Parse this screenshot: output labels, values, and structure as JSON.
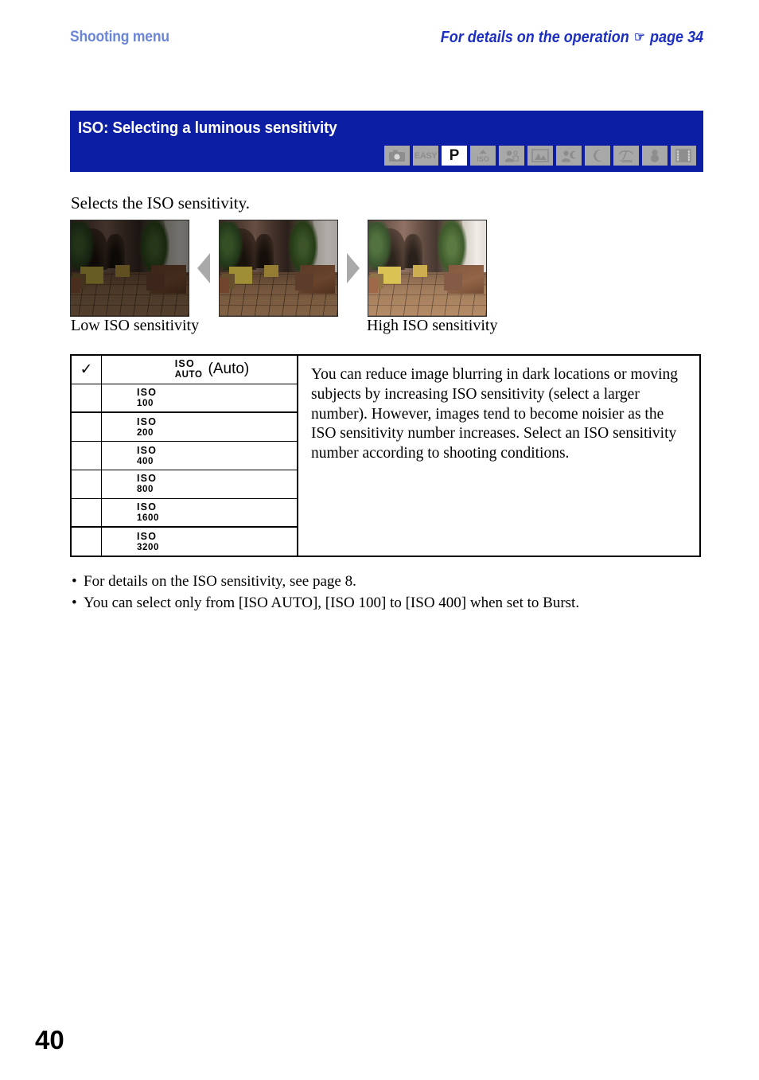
{
  "header": {
    "left_title": "Shooting menu",
    "right_text": "For details on the operation",
    "right_hand_icon": "pointing-hand-icon",
    "right_page_ref": "page 34"
  },
  "banner": {
    "title": "ISO: Selecting a luminous sensitivity",
    "background_color": "#0c1fa4",
    "modes": [
      {
        "name": "still-image-mode",
        "icon": "camera-icon",
        "label": "",
        "active": false
      },
      {
        "name": "easy-shooting-mode",
        "icon": "easy-text-icon",
        "label": "EASY",
        "active": false
      },
      {
        "name": "program-auto-mode",
        "icon": "p-text-icon",
        "label": "P",
        "active": true
      },
      {
        "name": "high-sensitivity-mode",
        "icon": "iso-up-icon",
        "label": "ISO",
        "active": false
      },
      {
        "name": "soft-snap-mode",
        "icon": "soft-snap-icon",
        "label": "",
        "active": false
      },
      {
        "name": "landscape-mode",
        "icon": "landscape-icon",
        "label": "",
        "active": false
      },
      {
        "name": "twilight-portrait-mode",
        "icon": "twilight-portrait-icon",
        "label": "",
        "active": false
      },
      {
        "name": "twilight-mode",
        "icon": "moon-icon",
        "label": "",
        "active": false
      },
      {
        "name": "beach-mode",
        "icon": "palm-tree-icon",
        "label": "",
        "active": false
      },
      {
        "name": "snow-mode",
        "icon": "snowman-icon",
        "label": "",
        "active": false
      },
      {
        "name": "movie-mode",
        "icon": "film-strip-icon",
        "label": "",
        "active": false
      }
    ]
  },
  "intro": "Selects the ISO sensitivity.",
  "photos": {
    "caption_low": "Low ISO sensitivity",
    "caption_high": "High ISO sensitivity",
    "arrow_left_icon": "triangle-left-icon",
    "arrow_right_icon": "triangle-right-icon"
  },
  "table": {
    "options": [
      {
        "checked": true,
        "check_icon": "check-mark-icon",
        "iso_top": "ISO",
        "iso_bottom": "AUTO",
        "suffix": "(Auto)"
      },
      {
        "checked": false,
        "iso_top": "ISO",
        "iso_bottom": "100",
        "suffix": ""
      },
      {
        "checked": false,
        "iso_top": "ISO",
        "iso_bottom": "200",
        "suffix": ""
      },
      {
        "checked": false,
        "iso_top": "ISO",
        "iso_bottom": "400",
        "suffix": ""
      },
      {
        "checked": false,
        "iso_top": "ISO",
        "iso_bottom": "800",
        "suffix": ""
      },
      {
        "checked": false,
        "iso_top": "ISO",
        "iso_bottom": "1600",
        "suffix": ""
      },
      {
        "checked": false,
        "iso_top": "ISO",
        "iso_bottom": "3200",
        "suffix": ""
      }
    ],
    "description": "You can reduce image blurring in dark locations or moving subjects by increasing ISO sensitivity (select a larger number). However, images tend to become noisier as the ISO sensitivity number increases. Select an ISO sensitivity number according to shooting conditions."
  },
  "notes": [
    "For details on the ISO sensitivity, see page 8.",
    "You can select only from [ISO AUTO], [ISO 100] to [ISO 400] when set to Burst."
  ],
  "page_number": "40"
}
